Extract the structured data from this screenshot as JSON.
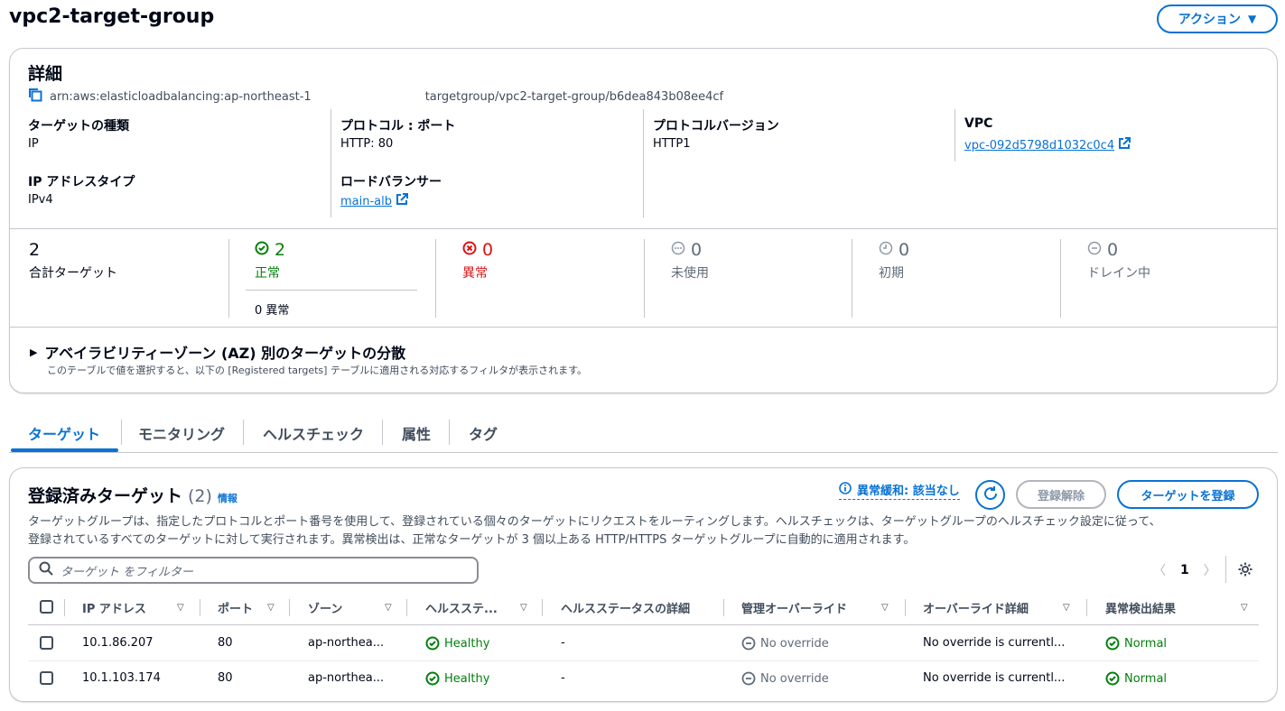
{
  "page": {
    "title": "vpc2-target-group",
    "actions_label": "アクション"
  },
  "details": {
    "heading": "詳細",
    "arn_left": "arn:aws:elasticloadbalancing:ap-northeast-1",
    "arn_right": "targetgroup/vpc2-target-group/b6dea843b08ee4cf",
    "target_type_label": "ターゲットの種類",
    "target_type_value": "IP",
    "protocol_port_label": "プロトコル : ポート",
    "protocol_port_value": "HTTP: 80",
    "protocol_version_label": "プロトコルバージョン",
    "protocol_version_value": "HTTP1",
    "vpc_label": "VPC",
    "vpc_value": "vpc-092d5798d1032c0c4",
    "ip_type_label": "IP アドレスタイプ",
    "ip_type_value": "IPv4",
    "lb_label": "ロードバランサー",
    "lb_value": "main-alb"
  },
  "counts": {
    "total_num": "2",
    "total_label": "合計ターゲット",
    "healthy_num": "2",
    "healthy_label": "正常",
    "healthy_anomaly": "0 異常",
    "unhealthy_num": "0",
    "unhealthy_label": "異常",
    "unused_num": "0",
    "unused_label": "未使用",
    "initial_num": "0",
    "initial_label": "初期",
    "draining_num": "0",
    "draining_label": "ドレイン中"
  },
  "az": {
    "title": "アベイラビリティーゾーン (AZ) 別のターゲットの分散",
    "subtitle": "このテーブルで値を選択すると、以下の [Registered targets] テーブルに適用される対応するフィルタが表示されます。"
  },
  "tabs": [
    "ターゲット",
    "モニタリング",
    "ヘルスチェック",
    "属性",
    "タグ"
  ],
  "targets": {
    "title": "登録済みターゲット",
    "count": "(2)",
    "info": "情報",
    "mitigation": "異常緩和: 該当なし",
    "deregister": "登録解除",
    "register": "ターゲットを登録",
    "description_line1": "ターゲットグループは、指定したプロトコルとポート番号を使用して、登録されている個々のターゲットにリクエストをルーティングします。ヘルスチェックは、ターゲットグループのヘルスチェック設定に従って、",
    "description_line2": "登録されているすべてのターゲットに対して実行されます。異常検出は、正常なターゲットが 3 個以上ある HTTP/HTTPS ターゲットグループに自動的に適用されます。",
    "filter_placeholder": "ターゲット をフィルター",
    "page": "1",
    "columns": [
      "IP アドレス",
      "ポート",
      "ゾーン",
      "ヘルスステ...",
      "ヘルスステータスの詳細",
      "管理オーバーライド",
      "オーバーライド詳細",
      "異常検出結果"
    ],
    "rows": [
      {
        "ip": "10.1.86.207",
        "port": "80",
        "zone": "ap-northea...",
        "health": "Healthy",
        "health_detail": "-",
        "override": "No override",
        "override_detail": "No override is currentl...",
        "anomaly": "Normal"
      },
      {
        "ip": "10.1.103.174",
        "port": "80",
        "zone": "ap-northea...",
        "health": "Healthy",
        "health_detail": "-",
        "override": "No override",
        "override_detail": "No override is currentl...",
        "anomaly": "Normal"
      }
    ]
  },
  "colors": {
    "link": "#0972d3",
    "success": "#037f0c",
    "error": "#d91515",
    "muted": "#5f6b7a",
    "border": "#c6c6cd"
  }
}
